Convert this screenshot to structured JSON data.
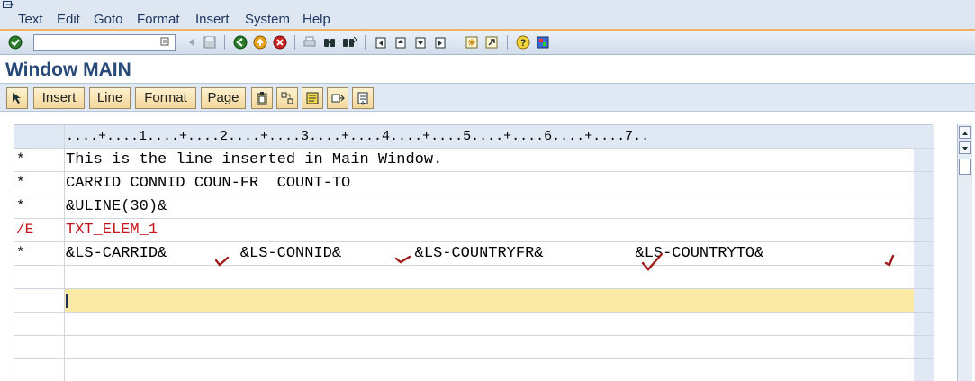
{
  "menu": [
    {
      "key": "text",
      "label": "Text"
    },
    {
      "key": "edit",
      "label": "Edit"
    },
    {
      "key": "goto",
      "label": "Goto"
    },
    {
      "key": "format",
      "label": "Format"
    },
    {
      "key": "insert",
      "label": "Insert"
    },
    {
      "key": "system",
      "label": "System"
    },
    {
      "key": "help",
      "label": "Help"
    }
  ],
  "toolbar": {
    "command_field": "",
    "icons": [
      "enter-icon",
      "back-icon",
      "save-icon",
      "green-back-icon",
      "exit-icon",
      "cancel-icon",
      "print-icon",
      "find-icon",
      "find-next-icon",
      "first-page-icon",
      "previous-page-icon",
      "next-page-icon",
      "last-page-icon",
      "create-session-icon",
      "shortcut-icon",
      "help-icon",
      "customize-layout-icon"
    ]
  },
  "title": "Window MAIN",
  "app_toolbar": {
    "buttons": [
      {
        "key": "insert",
        "label": "Insert"
      },
      {
        "key": "line",
        "label": "Line"
      },
      {
        "key": "format",
        "label": "Format"
      },
      {
        "key": "page",
        "label": "Page"
      }
    ],
    "icons": [
      "select-icon",
      "paste-icon",
      "split-lines-icon",
      "copy-block-icon",
      "move-icon",
      "clipboard-icon"
    ]
  },
  "editor": {
    "ruler": "....+....1....+....2....+....3....+....4....+....5....+....6....+....7..",
    "lines": [
      {
        "format": "*",
        "text": "This is the line inserted in Main Window.",
        "style": "normal"
      },
      {
        "format": "*",
        "text": "CARRID CONNID COUN-FR  COUNT-TO",
        "style": "normal"
      },
      {
        "format": "*",
        "text": "&ULINE(30)&",
        "style": "normal"
      },
      {
        "format": "/E",
        "text": "TXT_ELEM_1",
        "style": "red"
      },
      {
        "format": "*",
        "text": "&LS-CARRID&        &LS-CONNID&        &LS-COUNTRYFR&          &LS-COUNTRYTO&",
        "style": "normal"
      },
      {
        "format": "",
        "text": "",
        "style": "normal"
      },
      {
        "format": "",
        "text": "",
        "style": "cursor"
      },
      {
        "format": "",
        "text": "",
        "style": "normal"
      },
      {
        "format": "",
        "text": "",
        "style": "normal"
      },
      {
        "format": "",
        "text": "",
        "style": "normal"
      }
    ],
    "check_marks": 4,
    "check_color": "#a01c1c"
  },
  "colors": {
    "accent": "#f0b25a",
    "title": "#274a79",
    "cursor_line": "#fbe9a6"
  }
}
